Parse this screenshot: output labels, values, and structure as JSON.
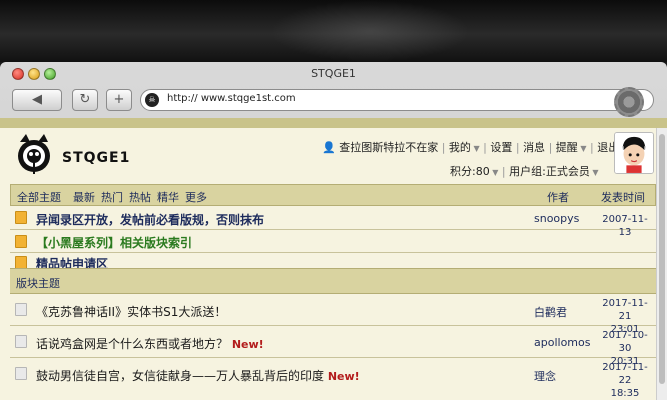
{
  "window": {
    "title": "STQGE1"
  },
  "toolbar": {
    "url": "http:// www.stqge1st.com",
    "favicon_text": "☠"
  },
  "site": {
    "brand": "STQGE1"
  },
  "userbar": {
    "username": "查拉图斯特拉不在家",
    "mine": "我的",
    "settings": "设置",
    "messages": "消息",
    "reminders": "提醒",
    "logout": "退出",
    "points": "积分:80",
    "group": "用户组:正式会员"
  },
  "nav": {
    "all": "全部主题",
    "latest": "最新",
    "hot": "热门",
    "hot_posts": "热帖",
    "digest": "精华",
    "more": "更多",
    "author_col": "作者",
    "time_col": "发表时间"
  },
  "pinned": [
    {
      "title": "异闻录区开放，发帖前必看版规，否则抹布",
      "author": "snoopys",
      "date": "2007-11-13"
    },
    {
      "title": "【小黑屋系列】相关版块索引",
      "author": "",
      "date": ""
    },
    {
      "title": "精品帖申请区",
      "author": "",
      "date": ""
    }
  ],
  "section": {
    "label": "版块主题"
  },
  "threads": [
    {
      "title": "《克苏鲁神话II》实体书S1大派送！",
      "badge": "",
      "author": "白鹳君",
      "date": "2017-11-21",
      "time": "23:01"
    },
    {
      "title": "话说鸡盒网是个什么东西或者地方？",
      "badge": "New!",
      "author": "apollomos",
      "date": "2017-10-30",
      "time": "20:31"
    },
    {
      "title": "鼓动男信徒自宫，女信徒献身——万人暴乱背后的印度",
      "badge": "New!",
      "author": "理念",
      "date": "2017-11-22",
      "time": "18:35"
    }
  ]
}
